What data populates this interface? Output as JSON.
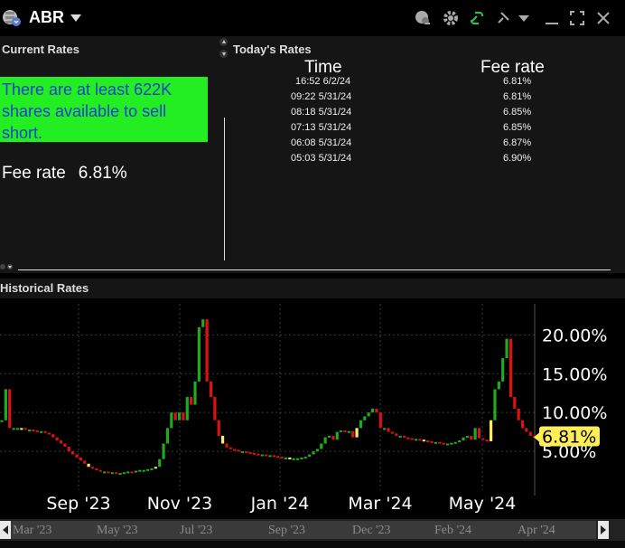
{
  "window": {
    "ticker": "ABR"
  },
  "colors": {
    "accent_green": "#22ee22",
    "info_text_blue": "#1f3fd0",
    "up_candle": "#1faa1f",
    "down_candle": "#dd1111",
    "current_tag": "#ffee55"
  },
  "toolbar": {
    "icons": [
      "chat-icon",
      "gear-icon",
      "link-icon",
      "pin-icon",
      "dropdown-icon",
      "minimize-icon",
      "expand-icon",
      "close-icon"
    ]
  },
  "current_rates": {
    "title": "Current Rates",
    "availability_text": "There are at least 622K shares available to sell short.",
    "fee_label": "Fee rate",
    "fee_value": "6.81%"
  },
  "todays_rates": {
    "title": "Today's Rates",
    "col_time": "Time",
    "col_fee": "Fee rate",
    "rows": [
      {
        "time": "16:52  6/2/24",
        "fee": "6.81%"
      },
      {
        "time": "09:22  5/31/24",
        "fee": "6.81%"
      },
      {
        "time": "08:18  5/31/24",
        "fee": "6.85%"
      },
      {
        "time": "07:13  5/31/24",
        "fee": "6.85%"
      },
      {
        "time": "06:08  5/31/24",
        "fee": "6.87%"
      },
      {
        "time": "05:03  5/31/24",
        "fee": "6.90%"
      }
    ]
  },
  "historical": {
    "title": "Historical Rates",
    "current_tag": "6.81%",
    "scroll_labels": [
      "Mar '23",
      "May '23",
      "Jul '23",
      "Sep '23",
      "Dec '23",
      "Feb '24",
      "Apr '24"
    ]
  },
  "chart_data": {
    "type": "bar",
    "title": "",
    "x_ticks": [
      "Sep '23",
      "Nov '23",
      "Jan '24",
      "Mar '24",
      "May '24"
    ],
    "y_ticks": [
      "5.00%",
      "10.00%",
      "15.00%",
      "20.00%"
    ],
    "ylim": [
      0,
      24
    ],
    "grid": true,
    "note": "daily fee-rate candles, values in percent",
    "series": [
      {
        "values": [
          9,
          13,
          8,
          8,
          8,
          8,
          7.8,
          7.8,
          7.7,
          7.6,
          7.6,
          7.4,
          7.2,
          6.8,
          6.4,
          6,
          5.6,
          5,
          4.6,
          4.2,
          3.8,
          3.4,
          3,
          2.8,
          2.6,
          2.4,
          2.4,
          2.3,
          2.3,
          2.2,
          2.2,
          2.3,
          2.4,
          2.3,
          2.5,
          2.6,
          2.6,
          2.7,
          2.8,
          3,
          4,
          6,
          8,
          10,
          9,
          10,
          9,
          12,
          11,
          14,
          21,
          22,
          14,
          12,
          9,
          7,
          6,
          5.5,
          5.3,
          5.2,
          5,
          5,
          4.9,
          4.8,
          4.7,
          4.6,
          4.6,
          4.5,
          4.5,
          4.4,
          4.3,
          4.2,
          4.2,
          4.1,
          4.1,
          4.1,
          4.2,
          4.3,
          4.6,
          5,
          5.3,
          6,
          6.8,
          7,
          6.5,
          7.5,
          7.7,
          7.5,
          7.6,
          6.8,
          8,
          9,
          9.5,
          10,
          10.5,
          10,
          8,
          8,
          7.5,
          7.3,
          7,
          7,
          6.8,
          6.7,
          6.6,
          6.6,
          6.5,
          6.4,
          6.3,
          6.2,
          6.2,
          6.1,
          6,
          6,
          6.1,
          6.2,
          6.4,
          6.8,
          7,
          6.5,
          8,
          6.7,
          6.5,
          6.3,
          9,
          13,
          14,
          17,
          19.5,
          12,
          10.5,
          9,
          8,
          7.5,
          7,
          6.85,
          6.81
        ]
      }
    ]
  }
}
